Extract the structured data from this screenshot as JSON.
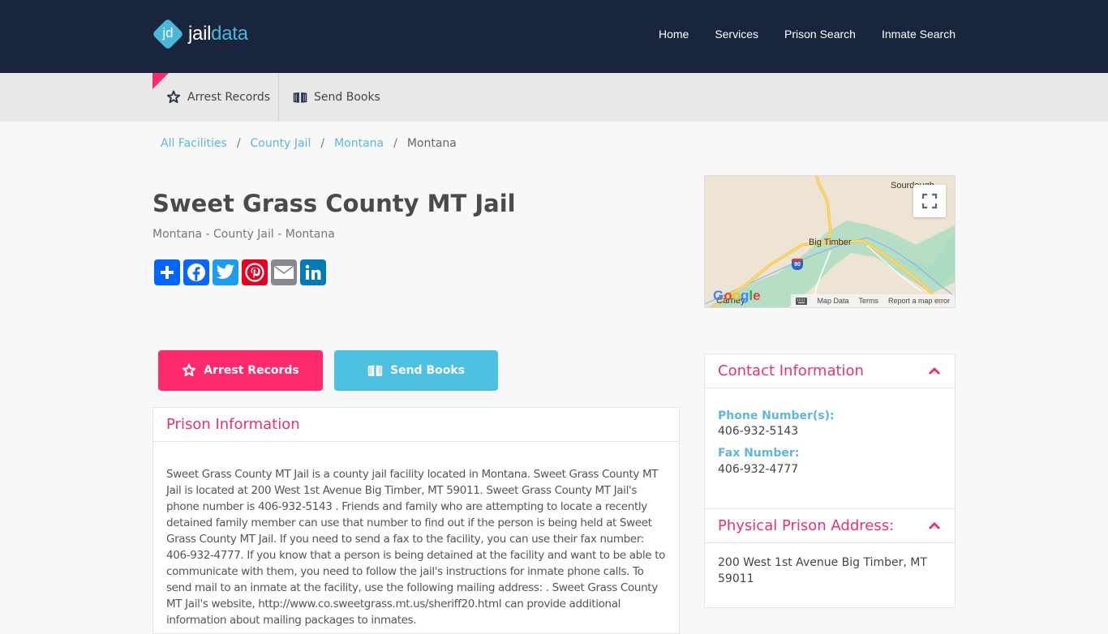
{
  "brand": {
    "jd": "jd",
    "name_part1": "jail",
    "name_part2": "data"
  },
  "nav": {
    "items": [
      {
        "label": "Home"
      },
      {
        "label": "Services"
      },
      {
        "label": "Prison Search"
      },
      {
        "label": "Inmate Search"
      }
    ]
  },
  "subnav": {
    "items": [
      {
        "label": "Arrest Records",
        "icon": "sheriff-star-icon"
      },
      {
        "label": "Send Books",
        "icon": "open-book-icon"
      }
    ]
  },
  "breadcrumb": {
    "items": [
      "All Facilities",
      "County Jail",
      "Montana"
    ],
    "current": "Montana",
    "separator": "/"
  },
  "page": {
    "title": "Sweet Grass County MT Jail",
    "subtitle": "Montana - County Jail - Montana"
  },
  "share": {
    "buttons": [
      "Share",
      "Facebook",
      "Twitter",
      "Pinterest",
      "Email",
      "LinkedIn"
    ]
  },
  "map": {
    "labels": {
      "town": "Big Timber",
      "north": "Sourdough",
      "southwest": "Carney",
      "highway": "90"
    },
    "footer": [
      "Map Data",
      "Terms",
      "Report a map error"
    ],
    "google": "Google"
  },
  "actions": {
    "arrest_records": "Arrest Records",
    "send_books": "Send Books"
  },
  "prison_info": {
    "heading": "Prison Information",
    "text": "Sweet Grass County MT Jail is a county jail facility located in Montana. Sweet Grass County MT Jail is located at 200 West 1st Avenue Big Timber, MT 59011. Sweet Grass County MT Jail's phone number is 406-932-5143 . Friends and family who are attempting to locate a recently detained family member can use that number to find out if the person is being held at Sweet Grass County MT Jail. If you need to send a fax to the facility, you can use their fax number: 406-932-4777. If you know that a person is being detained at the facility and want to be able to communicate with them, you need to follow the jail's instructions for inmate phone calls. To send mail to an inmate at the facility, use the following mailing address: . Sweet Grass County MT Jail's website, http://www.co.sweetgrass.mt.us/sheriff20.html can provide additional information about mailing packages to inmates."
  },
  "contact": {
    "heading": "Contact Information",
    "phone_label": "Phone Number(s):",
    "phone": "406-932-5143",
    "fax_label": "Fax Number:",
    "fax": "406-932-4777"
  },
  "address": {
    "heading": "Physical Prison Address:",
    "line1": "200 West 1st Avenue Big Timber, MT",
    "line2": "59011"
  },
  "colors": {
    "navy": "#19253d",
    "pink": "#ff2a6b",
    "cyan": "#4ec0e0",
    "accent_text": "#e8336a",
    "link": "#5fb8d8"
  }
}
